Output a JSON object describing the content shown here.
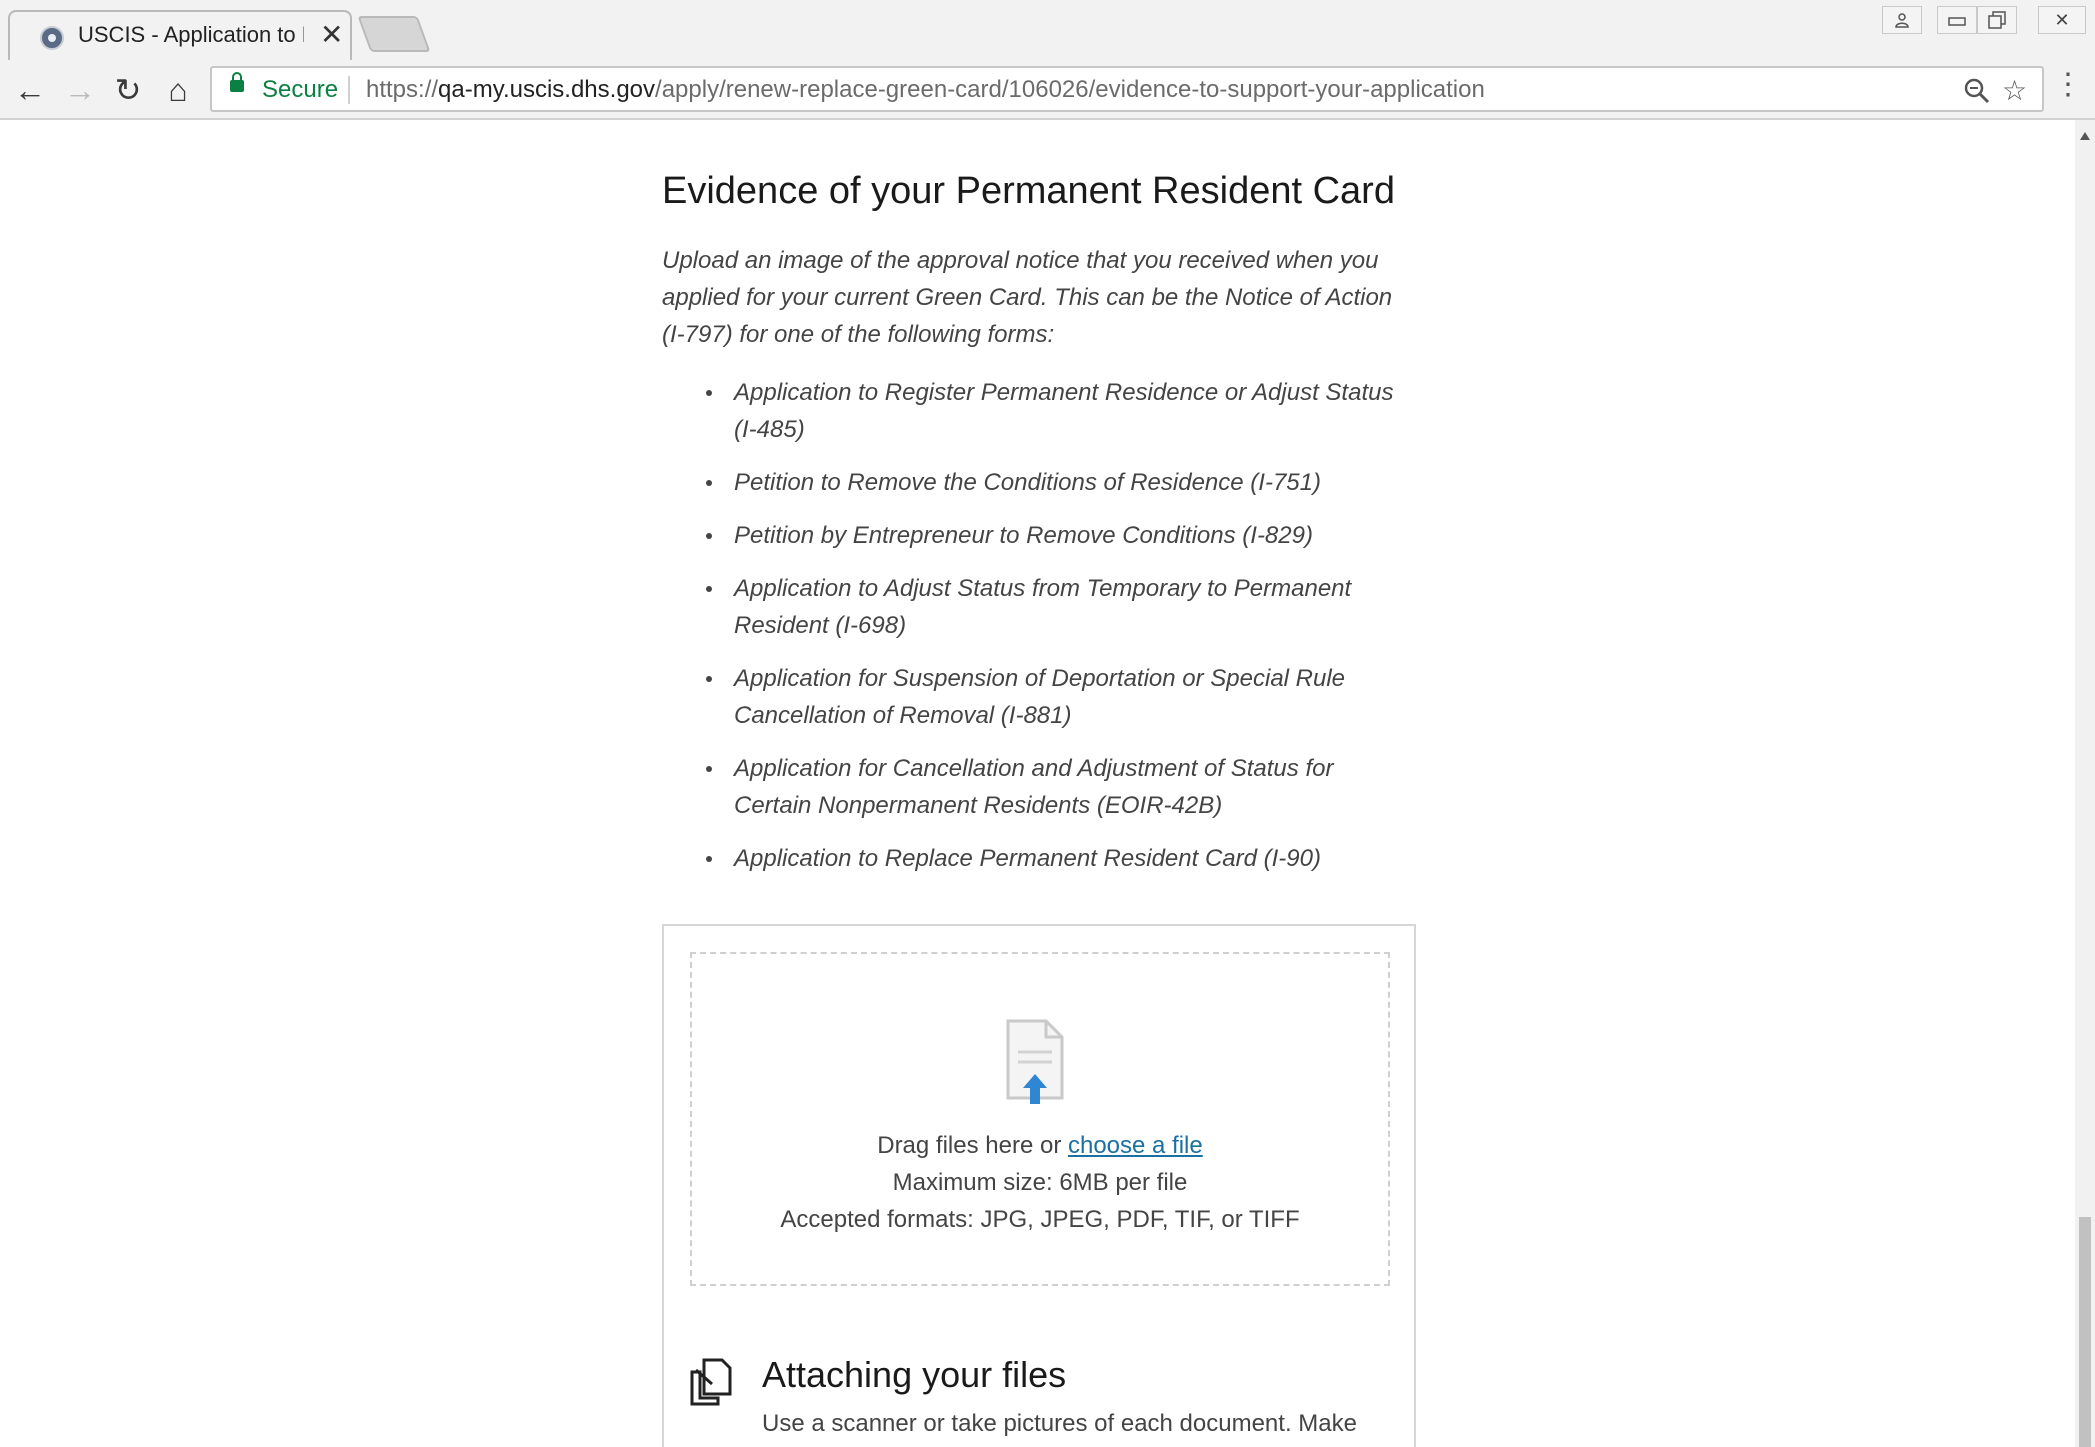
{
  "browser": {
    "tab_title": "USCIS - Application to Re",
    "tab_close": "✕",
    "secure_label": "Secure",
    "url_scheme": "https://",
    "url_host": "qa-my.uscis.dhs.gov",
    "url_path": "/apply/renew-replace-green-card/106026/evidence-to-support-your-application",
    "back": "←",
    "forward": "→",
    "reload": "↻",
    "home": "⌂",
    "zoom": "⚲",
    "bookmark": "☆",
    "menu": "⋮",
    "window_profile": "👤",
    "window_min": "▭",
    "window_restore": "❐",
    "window_close": "✕"
  },
  "section": {
    "title": "Evidence of your Permanent Resident Card",
    "intro": "Upload an image of the approval notice that you received when you applied for your current Green Card. This can be the Notice of Action (I-797) for one of the following forms:",
    "forms": [
      "Application to Register Permanent Residence or Adjust Status (I-485)",
      "Petition to Remove the Conditions of Residence (I-751)",
      "Petition by Entrepreneur to Remove Conditions (I-829)",
      "Application to Adjust Status from Temporary to Permanent Resident (I-698)",
      "Application for Suspension of Deportation or Special Rule Cancellation of Removal (I-881)",
      "Application for Cancellation and Adjustment of Status for Certain Nonpermanent Residents (EOIR-42B)",
      "Application to Replace Permanent Resident Card (I-90)"
    ]
  },
  "upload": {
    "drag_text": "Drag files here or ",
    "choose_link": "choose a file",
    "max_size": "Maximum size: 6MB per file",
    "formats": "Accepted formats: JPG, JPEG, PDF, TIF, or TIFF",
    "attach_title": "Attaching your files",
    "attach_text": "Use a scanner or take pictures of each document. Make"
  },
  "colors": {
    "link": "#1a6fa3",
    "secure_green": "#0b8043",
    "upload_arrow": "#2f86d3"
  }
}
